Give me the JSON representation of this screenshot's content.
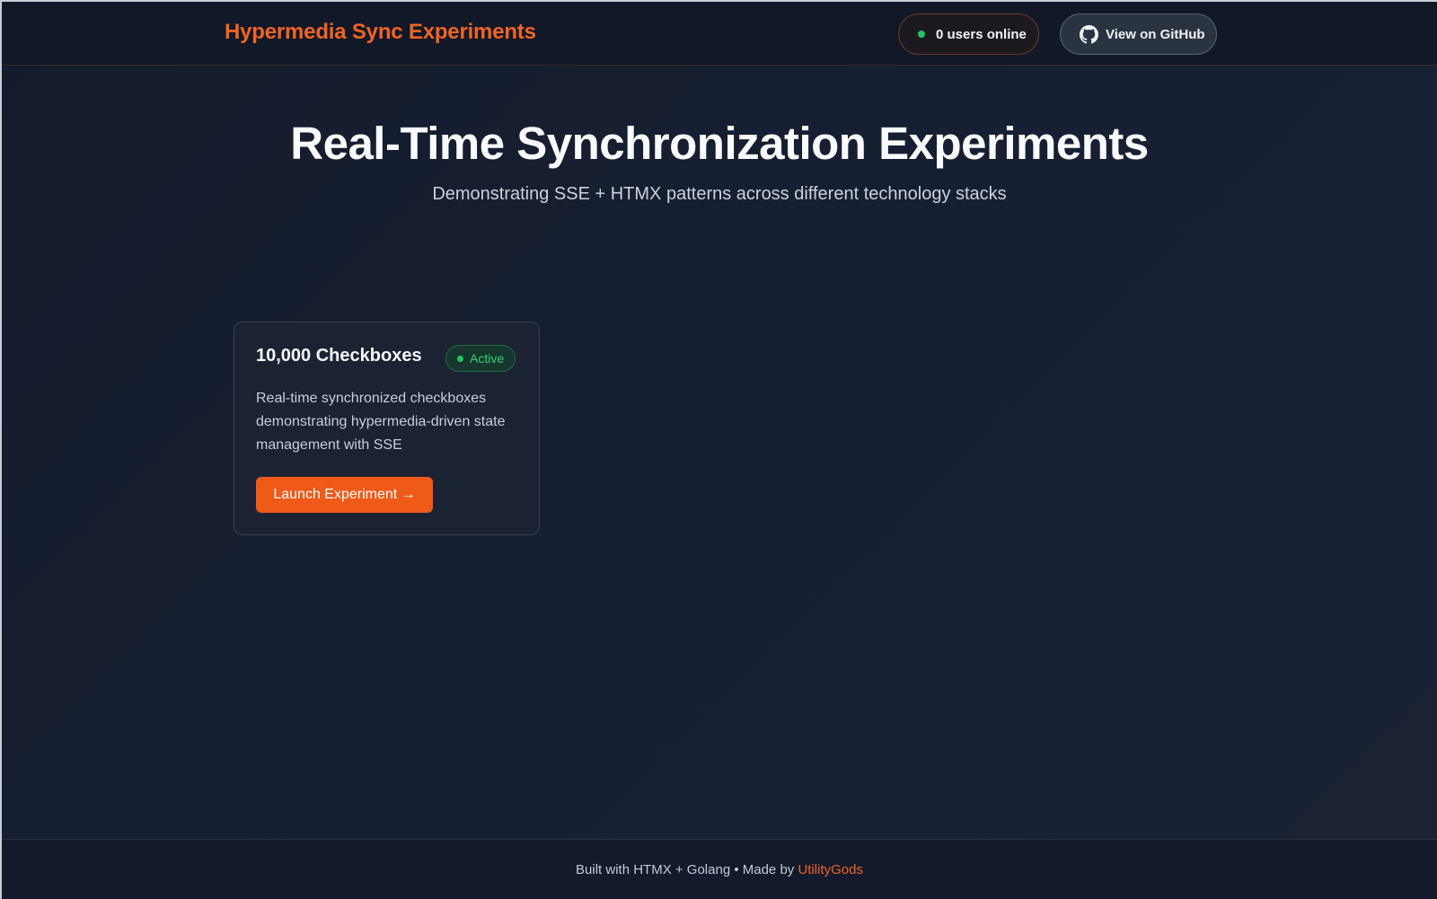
{
  "header": {
    "brand": "Hypermedia Sync Experiments",
    "users_online": "0 users online",
    "github_label": "View on GitHub",
    "github_icon": "github-icon"
  },
  "hero": {
    "title": "Real-Time Synchronization Experiments",
    "subtitle": "Demonstrating SSE + HTMX patterns across different technology stacks"
  },
  "experiments": [
    {
      "title": "10,000 Checkboxes",
      "status": "Active",
      "description": "Real-time synchronized checkboxes demonstrating hypermedia-driven state management with SSE",
      "button_label": "Launch Experiment →"
    }
  ],
  "footer": {
    "text": "Built with HTMX + Golang • Made by",
    "link_label": "UtilityGods"
  },
  "colors": {
    "accent": "#f06424",
    "button": "#ef5a19",
    "status_green": "#22c55e",
    "background": "#141b2d"
  }
}
